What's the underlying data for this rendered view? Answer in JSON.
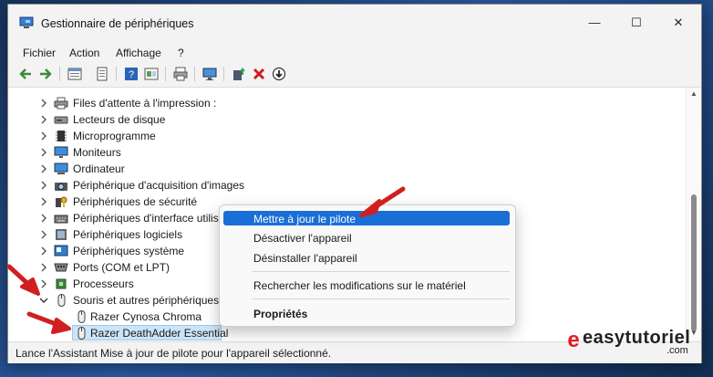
{
  "window": {
    "title": "Gestionnaire de périphériques",
    "controls": {
      "minimize": "—",
      "maximize": "☐",
      "close": "✕"
    }
  },
  "menu": [
    "Fichier",
    "Action",
    "Affichage",
    "?"
  ],
  "toolbar_icons": [
    "back-icon",
    "forward-icon",
    "properties-view-icon",
    "list-icon",
    "help-icon",
    "view-icon",
    "print-icon",
    "monitor-icon",
    "update-driver-icon",
    "uninstall-icon",
    "enable-device-icon"
  ],
  "tree": {
    "categories": [
      {
        "label": "Files d'attente à l'impression :",
        "icon": "printer-icon",
        "expanded": false
      },
      {
        "label": "Lecteurs de disque",
        "icon": "disk-drive-icon",
        "expanded": false
      },
      {
        "label": "Microprogramme",
        "icon": "firmware-icon",
        "expanded": false
      },
      {
        "label": "Moniteurs",
        "icon": "monitor-icon",
        "expanded": false
      },
      {
        "label": "Ordinateur",
        "icon": "computer-icon",
        "expanded": false
      },
      {
        "label": "Périphérique d'acquisition d'images",
        "icon": "camera-icon",
        "expanded": false
      },
      {
        "label": "Périphériques de sécurité",
        "icon": "security-key-icon",
        "expanded": false
      },
      {
        "label": "Périphériques d'interface utilisa",
        "icon": "hid-icon",
        "expanded": false
      },
      {
        "label": "Périphériques logiciels",
        "icon": "software-device-icon",
        "expanded": false
      },
      {
        "label": "Périphériques système",
        "icon": "system-device-icon",
        "expanded": false
      },
      {
        "label": "Ports (COM et LPT)",
        "icon": "port-icon",
        "expanded": false
      },
      {
        "label": "Processeurs",
        "icon": "processor-icon",
        "expanded": false
      },
      {
        "label": "Souris et autres périphériques d",
        "icon": "mouse-icon",
        "expanded": true
      }
    ],
    "children": [
      {
        "label": "Razer Cynosa Chroma",
        "icon": "mouse-icon",
        "selected": false
      },
      {
        "label": "Razer DeathAdder Essential",
        "icon": "mouse-icon",
        "selected": true
      }
    ]
  },
  "context_menu": {
    "items": [
      {
        "label": "Mettre à jour le pilote",
        "highlighted": true
      },
      {
        "label": "Désactiver l'appareil"
      },
      {
        "label": "Désinstaller l'appareil"
      },
      {
        "label": "Rechercher les modifications sur le matériel"
      },
      {
        "label": "Propriétés",
        "bold": true
      }
    ]
  },
  "status": "Lance l'Assistant Mise à jour de pilote pour l'appareil sélectionné.",
  "watermark": {
    "text": "easytutoriel",
    "suffix": ".com",
    "color": "#e31b23"
  },
  "colors": {
    "accent": "#1a6fd6",
    "selection": "#cce4f7",
    "annotation_arrow": "#d11f1f"
  }
}
